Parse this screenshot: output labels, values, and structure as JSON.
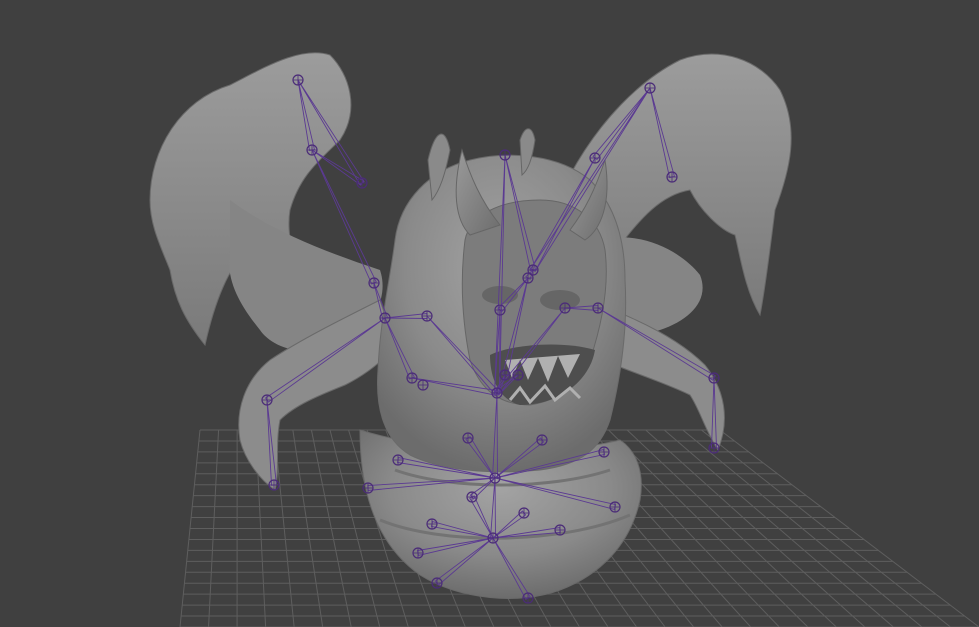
{
  "viewport": {
    "background": "#404040",
    "grid_color": "#5e5e5e",
    "mesh_fill": "#8a8a8a",
    "mesh_shadow": "#6f6f6f",
    "mesh_highlight": "#a6a6a6",
    "joint_color": "#4b2c78",
    "bone_color": "#5b3a92"
  },
  "scene": {
    "object": "creature-mesh",
    "rig": "joint-skeleton",
    "grid": "ground-grid"
  }
}
